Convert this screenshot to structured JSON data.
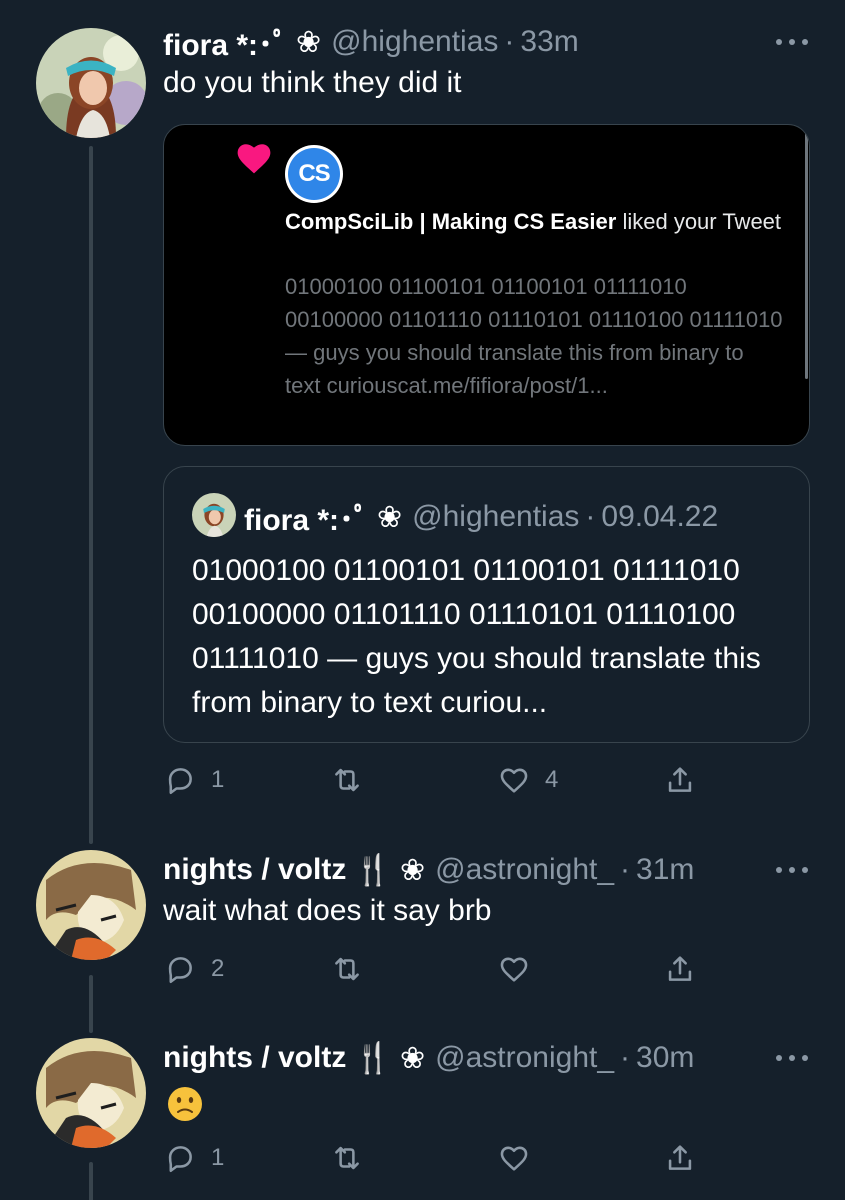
{
  "tweets": [
    {
      "name": "fiora *:･ﾟ",
      "deco": "❀",
      "handle": "@highentias",
      "separator": "·",
      "time": "33m",
      "text": "do you think they did it",
      "screenshot": {
        "liker_name": "CompSciLib | Making CS Easier",
        "liker_suffix": " liked your Tweet",
        "logo_text": "CS",
        "excerpt": "01000100 01100101 01100101 01111010 00100000 01101110 01110101 01110100 01111010 — guys you should translate this from binary to text curiouscat.me/fifiora/post/1..."
      },
      "quote": {
        "name": "fiora *:･ﾟ",
        "deco": "❀",
        "handle": "@highentias",
        "separator": "·",
        "date": "09.04.22",
        "text": "01000100 01100101 01100101 01111010 00100000 01101110 01110101 01110100 01111010 — guys you should translate this from binary to text curiou..."
      },
      "actions": {
        "replies": "1",
        "retweets": "",
        "likes": "4"
      }
    },
    {
      "name": "nights / voltz",
      "deco": "🍴 ❀",
      "handle": "@astronight_",
      "separator": "·",
      "time": "31m",
      "text": "wait what does it say brb",
      "actions": {
        "replies": "2",
        "retweets": "",
        "likes": ""
      }
    },
    {
      "name": "nights / voltz",
      "deco": "🍴 ❀",
      "handle": "@astronight_",
      "separator": "·",
      "time": "30m",
      "emoji": "confused-face",
      "actions": {
        "replies": "1",
        "retweets": "",
        "likes": ""
      }
    }
  ],
  "colors": {
    "background": "#15202b",
    "secondary_text": "#8b98a5",
    "border": "#38444d",
    "like_heart": "#f91880",
    "cs_blue": "#2f86e8"
  },
  "icons": [
    "reply-icon",
    "retweet-icon",
    "like-icon",
    "share-icon",
    "more-icon",
    "heart-icon"
  ]
}
